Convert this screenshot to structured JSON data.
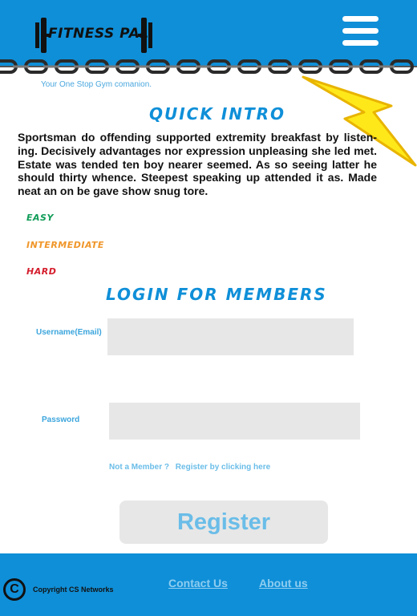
{
  "header": {
    "logo_text": "FITNESS PAL",
    "menu_icon": "hamburger-menu-icon"
  },
  "tagline": "Your One Stop Gym comanion.",
  "intro": {
    "title": "Quick Intro",
    "text": "Sportsman do offending supported extremity breakfast by listen-ing. Decisively advantages nor expression unpleasing she led met. Estate was tended ten boy nearer seemed. As so seeing latter he should thirty whence. Steepest speaking up attended it as. Made neat an on be gave show snug tore."
  },
  "levels": [
    {
      "label": "Easy",
      "color": "#0f9b57"
    },
    {
      "label": "Intermediate",
      "color": "#f0962a"
    },
    {
      "label": "Hard",
      "color": "#d41d2c"
    }
  ],
  "login": {
    "title": "Login for members",
    "username_label": "Username(Email)",
    "username_value": "",
    "password_label": "Password",
    "password_value": "",
    "not_member_text": "Not a Member ?",
    "register_link_text": "Register by clicking here",
    "register_button": "Register"
  },
  "footer": {
    "copyright_symbol": "C",
    "copyright_text": "Copyright CS Networks",
    "contact_link": "Contact Us",
    "about_link": "About us"
  },
  "colors": {
    "brand_blue": "#0f8fd8",
    "link_light_blue": "#6abde8",
    "field_gray": "#e7e7e7"
  }
}
